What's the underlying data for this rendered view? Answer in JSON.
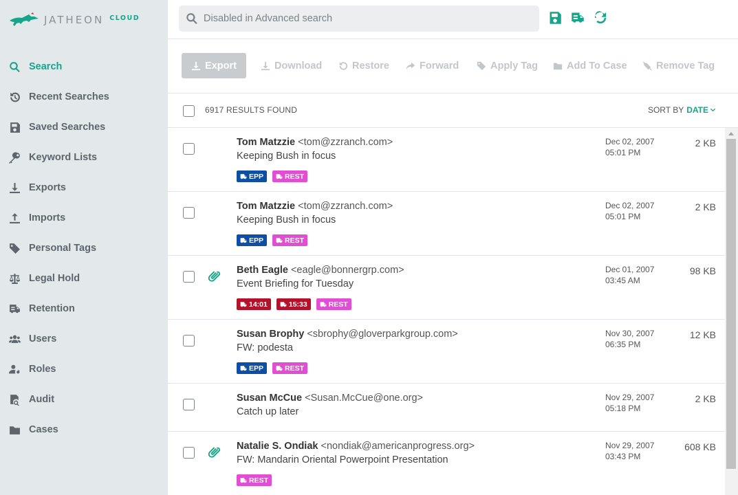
{
  "app": {
    "brand": "JATHEON",
    "brand_suffix": "CLOUD"
  },
  "colors": {
    "accent": "#17a589",
    "tag_epp": "#0e4ea3",
    "tag_rest": "#e04fd1",
    "tag_time": "#b3122b",
    "sidebar_bg": "#e3e8eb"
  },
  "sidebar": {
    "items": [
      {
        "label": "Search",
        "icon": "search-icon",
        "active": true
      },
      {
        "label": "Recent Searches",
        "icon": "history-icon"
      },
      {
        "label": "Saved Searches",
        "icon": "save-icon"
      },
      {
        "label": "Keyword Lists",
        "icon": "key-icon"
      },
      {
        "label": "Exports",
        "icon": "download-icon"
      },
      {
        "label": "Imports",
        "icon": "upload-icon"
      },
      {
        "label": "Personal Tags",
        "icon": "tag-icon"
      },
      {
        "label": "Legal Hold",
        "icon": "scale-icon"
      },
      {
        "label": "Retention",
        "icon": "retention-icon"
      },
      {
        "label": "Users",
        "icon": "users-icon"
      },
      {
        "label": "Roles",
        "icon": "roles-icon"
      },
      {
        "label": "Audit",
        "icon": "audit-icon"
      },
      {
        "label": "Cases",
        "icon": "folder-icon"
      }
    ]
  },
  "search": {
    "placeholder": "Disabled in Advanced search"
  },
  "toolbar": {
    "export": "Export",
    "download": "Download",
    "restore": "Restore",
    "forward": "Forward",
    "apply_tag": "Apply Tag",
    "add_to_case": "Add To Case",
    "remove_tag": "Remove Tag"
  },
  "results": {
    "count_label": "6917 RESULTS FOUND",
    "sort_label": "SORT BY",
    "sort_value": "DATE",
    "rows": [
      {
        "name": "Tom Matzzie",
        "email": "<tom@zzranch.com>",
        "subject": "Keeping Bush in focus",
        "date": "Dec 02, 2007",
        "time": "05:01 PM",
        "size": "2 KB",
        "attachment": false,
        "tags": [
          {
            "label": "EPP",
            "kind": "epp"
          },
          {
            "label": "REST",
            "kind": "rest"
          }
        ]
      },
      {
        "name": "Tom Matzzie",
        "email": "<tom@zzranch.com>",
        "subject": "Keeping Bush in focus",
        "date": "Dec 02, 2007",
        "time": "05:01 PM",
        "size": "2 KB",
        "attachment": false,
        "tags": [
          {
            "label": "EPP",
            "kind": "epp"
          },
          {
            "label": "REST",
            "kind": "rest"
          }
        ]
      },
      {
        "name": "Beth Eagle",
        "email": "<eagle@bonnergrp.com>",
        "subject": "Event Briefing for Tuesday",
        "date": "Dec 01, 2007",
        "time": "03:45 AM",
        "size": "98 KB",
        "attachment": true,
        "tags": [
          {
            "label": "14:01",
            "kind": "time"
          },
          {
            "label": "15:33",
            "kind": "time"
          },
          {
            "label": "REST",
            "kind": "rest"
          }
        ]
      },
      {
        "name": "Susan Brophy",
        "email": "<sbrophy@gloverparkgroup.com>",
        "subject": "FW: podesta",
        "date": "Nov 30, 2007",
        "time": "06:35 PM",
        "size": "12 KB",
        "attachment": false,
        "tags": [
          {
            "label": "EPP",
            "kind": "epp"
          },
          {
            "label": "REST",
            "kind": "rest"
          }
        ]
      },
      {
        "name": "Susan McCue",
        "email": "<Susan.McCue@one.org>",
        "subject": "Catch up later",
        "date": "Nov 29, 2007",
        "time": "05:18 PM",
        "size": "2 KB",
        "attachment": false,
        "tags": []
      },
      {
        "name": "Natalie S. Ondiak",
        "email": "<nondiak@americanprogress.org>",
        "subject": "FW: Mandarin Oriental Powerpoint Presentation",
        "date": "Nov 29, 2007",
        "time": "03:43 PM",
        "size": "608 KB",
        "attachment": true,
        "tags": [
          {
            "label": "REST",
            "kind": "rest"
          }
        ]
      }
    ]
  }
}
